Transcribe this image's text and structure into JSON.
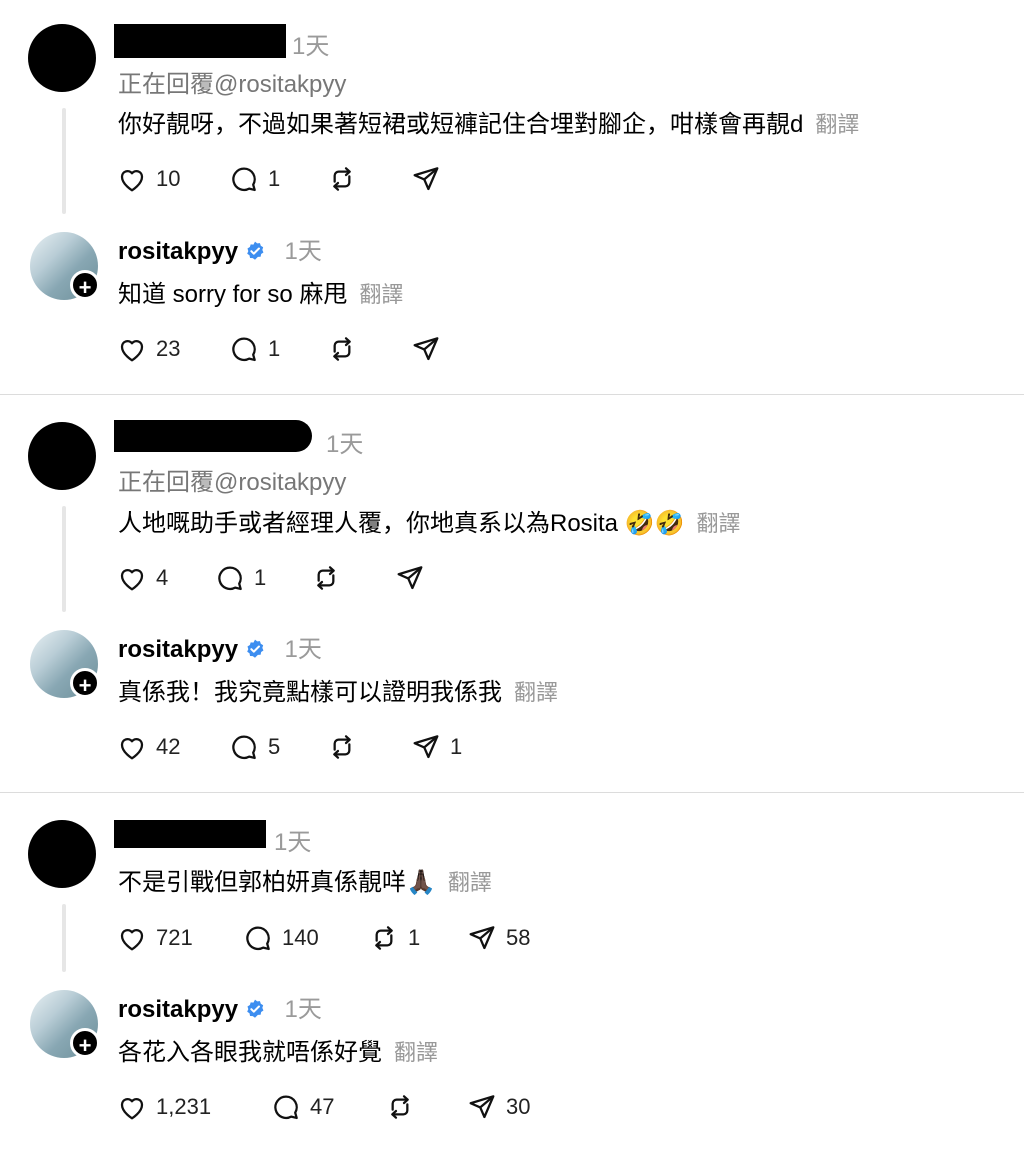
{
  "threads": [
    {
      "comment": {
        "time": "1天",
        "reply_to": "正在回覆@rositakpyy",
        "text": "你好靚呀，不過如果著短裙或短褲記住合埋對腳企，咁樣會再靚d",
        "translate": "翻譯",
        "likes": "10",
        "replies": "1",
        "reposts": "",
        "shares": ""
      },
      "reply": {
        "username": "rositakpyy",
        "time": "1天",
        "text": "知道 sorry for so 麻甩",
        "translate": "翻譯",
        "likes": "23",
        "replies": "1",
        "reposts": "",
        "shares": ""
      }
    },
    {
      "comment": {
        "time": "1天",
        "reply_to": "正在回覆@rositakpyy",
        "text": "人地嘅助手或者經理人覆，你地真系以為Rosita 🤣🤣",
        "translate": "翻譯",
        "likes": "4",
        "replies": "1",
        "reposts": "",
        "shares": ""
      },
      "reply": {
        "username": "rositakpyy",
        "time": "1天",
        "text": "真係我！我究竟點樣可以證明我係我",
        "translate": "翻譯",
        "likes": "42",
        "replies": "5",
        "reposts": "",
        "shares": "1"
      }
    },
    {
      "comment": {
        "time": "1天",
        "text": "不是引戰但郭柏妍真係靚咩🙏🏿",
        "translate": "翻譯",
        "likes": "721",
        "replies": "140",
        "reposts": "1",
        "shares": "58"
      },
      "reply": {
        "username": "rositakpyy",
        "time": "1天",
        "text": "各花入各眼我就唔係好覺",
        "translate": "翻譯",
        "likes": "1,231",
        "replies": "47",
        "reposts": "",
        "shares": "30"
      }
    }
  ],
  "icons": {
    "like": "heart-icon",
    "reply": "comment-icon",
    "repost": "repost-icon",
    "share": "send-icon",
    "verified": "verified-badge-icon",
    "follow": "plus-icon"
  },
  "colors": {
    "verified": "#3d8ef0",
    "muted": "#9a9a9a"
  }
}
